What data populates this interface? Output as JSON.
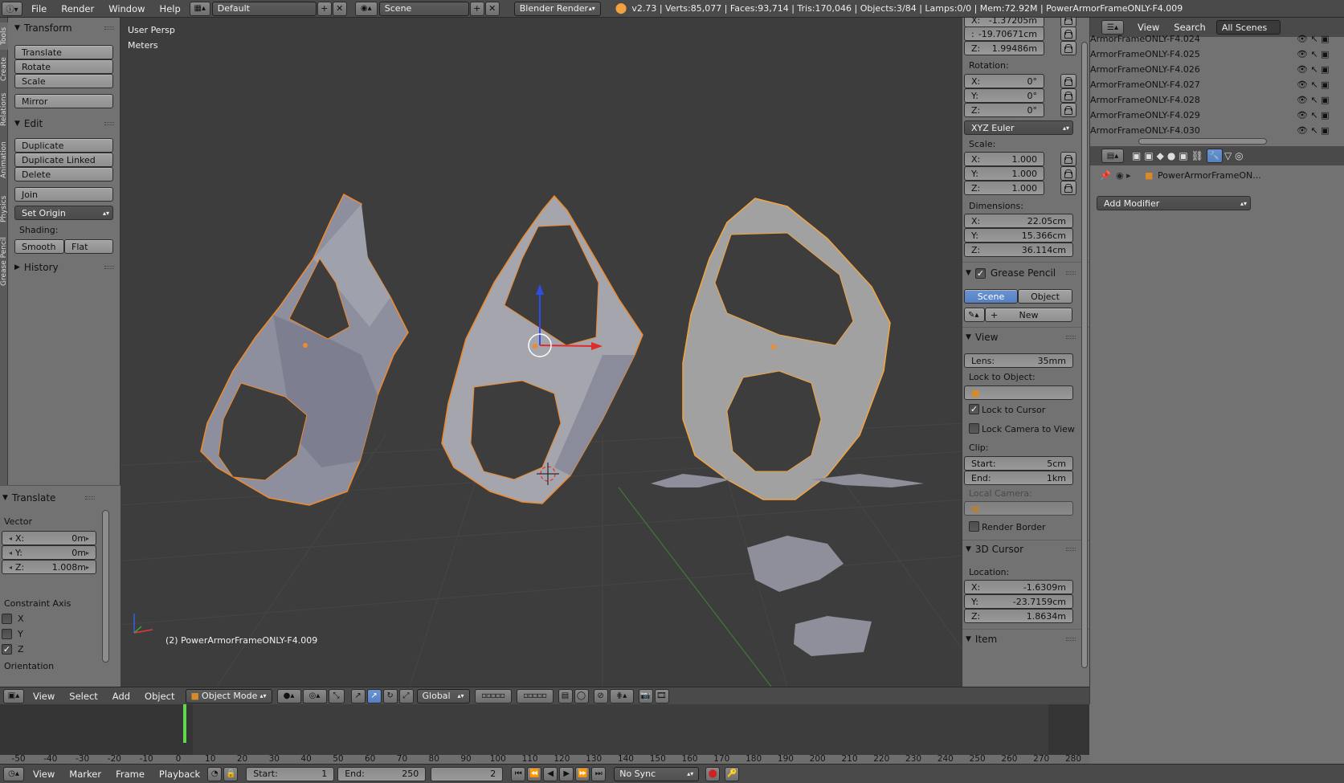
{
  "topbar": {
    "menus": [
      "File",
      "Render",
      "Window",
      "Help"
    ],
    "layout": "Default",
    "scene": "Scene",
    "engine": "Blender Render",
    "stats": "v2.73 | Verts:85,077 | Faces:93,714 | Tris:170,046 | Objects:3/84 | Lamps:0/0 | Mem:72.92M | PowerArmorFrameONLY-F4.009"
  },
  "vtabs": [
    "Tools",
    "Create",
    "Relations",
    "Animation",
    "Physics",
    "Grease Pencil"
  ],
  "toolshelf": {
    "transform": {
      "title": "Transform",
      "buttons": [
        "Translate",
        "Rotate",
        "Scale",
        "Mirror"
      ]
    },
    "edit": {
      "title": "Edit",
      "buttons": [
        "Duplicate",
        "Duplicate Linked",
        "Delete",
        "Join"
      ],
      "set_origin": "Set Origin",
      "shading_label": "Shading:",
      "smooth": "Smooth",
      "flat": "Flat"
    },
    "history": "History",
    "operator": {
      "title": "Translate",
      "vector_label": "Vector",
      "x_label": "X:",
      "x": "0m",
      "y_label": "Y:",
      "y": "0m",
      "z_label": "Z:",
      "z": "1.008m",
      "constraint_label": "Constraint Axis",
      "axes": [
        {
          "label": "X",
          "checked": false
        },
        {
          "label": "Y",
          "checked": false
        },
        {
          "label": "Z",
          "checked": true
        }
      ],
      "orientation_label": "Orientation"
    }
  },
  "viewport": {
    "view_name": "User Persp",
    "units": "Meters",
    "object_label": "(2) PowerArmorFrameONLY-F4.009"
  },
  "npanel": {
    "location": {
      "x": "-1.37205m",
      "y": "-19.70671cm",
      "z": "1.99486m"
    },
    "rotation_label": "Rotation:",
    "rotation": {
      "x": "0°",
      "y": "0°",
      "z": "0°"
    },
    "rotation_mode": "XYZ Euler",
    "scale_label": "Scale:",
    "scale": {
      "x": "1.000",
      "y": "1.000",
      "z": "1.000"
    },
    "dimensions_label": "Dimensions:",
    "dimensions": {
      "x": "22.05cm",
      "y": "15.366cm",
      "z": "36.114cm"
    },
    "grease_pencil": {
      "title": "Grease Pencil",
      "scene": "Scene",
      "object": "Object",
      "new": "New"
    },
    "view": {
      "title": "View",
      "lens": "Lens:",
      "lens_value": "35mm",
      "lock_object_label": "Lock to Object:",
      "lock_cursor": "Lock to Cursor",
      "lock_camera": "Lock Camera to View",
      "clip_label": "Clip:",
      "clip_start": "Start:",
      "clip_start_value": "5cm",
      "clip_end": "End:",
      "clip_end_value": "1km",
      "local_camera": "Local Camera:",
      "render_border": "Render Border"
    },
    "cursor": {
      "title": "3D Cursor",
      "location_label": "Location:",
      "x": "-1.6309m",
      "y": "-23.7159cm",
      "z": "1.8634m"
    },
    "item_title": "Item",
    "axis_labels": {
      "x": "X:",
      "y": "Y:",
      "z": "Z:"
    }
  },
  "outliner": {
    "menus": [
      "View",
      "Search"
    ],
    "filter": "All Scenes",
    "rows": [
      "ArmorFrameONLY-F4.024",
      "ArmorFrameONLY-F4.025",
      "ArmorFrameONLY-F4.026",
      "ArmorFrameONLY-F4.027",
      "ArmorFrameONLY-F4.028",
      "ArmorFrameONLY-F4.029",
      "ArmorFrameONLY-F4.030"
    ]
  },
  "properties": {
    "object_name": "PowerArmorFrameON...",
    "add_modifier": "Add Modifier"
  },
  "vheader": {
    "menus": [
      "View",
      "Select",
      "Add",
      "Object"
    ],
    "mode": "Object Mode",
    "orientation": "Global"
  },
  "timeline": {
    "ticks": [
      "-50",
      "-40",
      "-30",
      "-20",
      "-10",
      "0",
      "10",
      "20",
      "30",
      "40",
      "50",
      "60",
      "70",
      "80",
      "90",
      "100",
      "110",
      "120",
      "130",
      "140",
      "150",
      "160",
      "170",
      "180",
      "190",
      "200",
      "210",
      "220",
      "230",
      "240",
      "250",
      "260",
      "270",
      "280"
    ],
    "current_frame": 2,
    "menus": [
      "View",
      "Marker",
      "Frame",
      "Playback"
    ],
    "start_label": "Start:",
    "start": "1",
    "end_label": "End:",
    "end": "250",
    "frame": "2",
    "sync": "No Sync"
  },
  "colors": {
    "viewport_bg": "#3d3d3d",
    "selection_outline": "#f08a2b",
    "panel_bg": "#727272",
    "header_bg": "#4a4a4a",
    "active_blue": "#5680c2",
    "current_frame": "#5fd84a"
  }
}
